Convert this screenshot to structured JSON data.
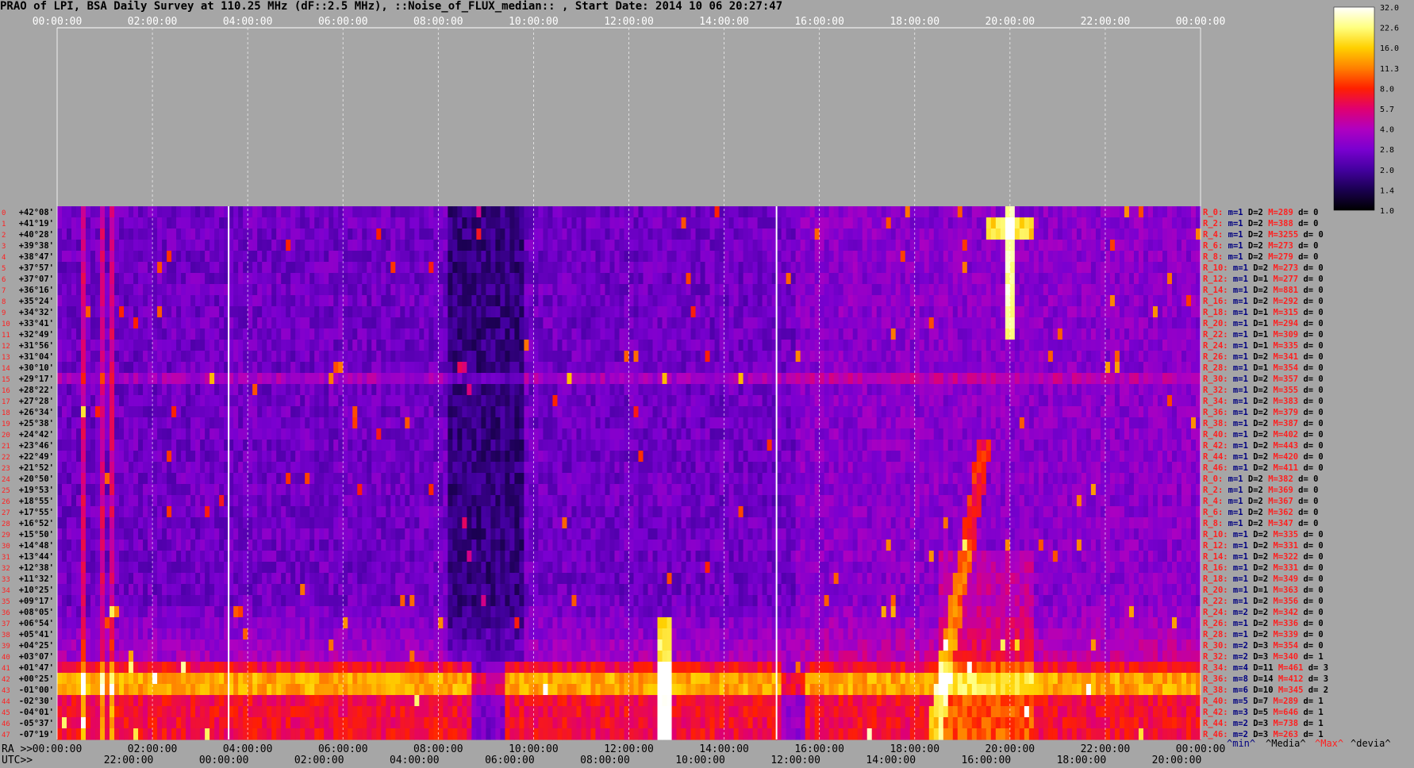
{
  "title": "PRAO of LPI, BSA Daily Survey at 110.25 MHz (dF::2.5 MHz), ::Noise_of_FLUX_median:: , Start Date: 2014 10 06 20:27:47",
  "chart_data": {
    "type": "heatmap",
    "top_time_ticks": [
      "00:00:00",
      "02:00:00",
      "04:00:00",
      "06:00:00",
      "08:00:00",
      "10:00:00",
      "12:00:00",
      "14:00:00",
      "16:00:00",
      "18:00:00",
      "20:00:00",
      "22:00:00",
      "00:00:00"
    ],
    "bottom_ra_prefix": "RA >>",
    "bottom_ra_ticks": [
      "00:00:00",
      "02:00:00",
      "04:00:00",
      "06:00:00",
      "08:00:00",
      "10:00:00",
      "12:00:00",
      "14:00:00",
      "16:00:00",
      "18:00:00",
      "20:00:00",
      "22:00:00",
      "00:00:00"
    ],
    "bottom_utc_prefix": "UTC>>",
    "bottom_utc_ticks": [
      "22:00:00",
      "00:00:00",
      "02:00:00",
      "04:00:00",
      "06:00:00",
      "08:00:00",
      "10:00:00",
      "12:00:00",
      "14:00:00",
      "16:00:00",
      "18:00:00",
      "20:00:00"
    ],
    "declinations": [
      "+42°08'",
      "+41°19'",
      "+40°28'",
      "+39°38'",
      "+38°47'",
      "+37°57'",
      "+37°07'",
      "+36°16'",
      "+35°24'",
      "+34°32'",
      "+33°41'",
      "+32°49'",
      "+31°56'",
      "+31°04'",
      "+30°10'",
      "+29°17'",
      "+28°22'",
      "+27°28'",
      "+26°34'",
      "+25°38'",
      "+24°42'",
      "+23°46'",
      "+22°49'",
      "+21°52'",
      "+20°50'",
      "+19°53'",
      "+18°55'",
      "+17°55'",
      "+16°52'",
      "+15°50'",
      "+14°48'",
      "+13°44'",
      "+12°38'",
      "+11°32'",
      "+10°25'",
      "+09°17'",
      "+08°05'",
      "+06°54'",
      "+05°41'",
      "+04°25'",
      "+03°07'",
      "+01°47'",
      "+00°25'",
      "-01°00'",
      "-02°30'",
      "-04°01'",
      "-05°37'",
      "-07°19'"
    ],
    "row_stats": [
      {
        "r": "R_0:",
        "m": "m=1",
        "d": "D=2",
        "M": "M=289",
        "dv": "d= 0"
      },
      {
        "r": "R_2:",
        "m": "m=1",
        "d": "D=2",
        "M": "M=388",
        "dv": "d= 0"
      },
      {
        "r": "R_4:",
        "m": "m=1",
        "d": "D=2",
        "M": "M=3255",
        "dv": "d= 0"
      },
      {
        "r": "R_6:",
        "m": "m=1",
        "d": "D=2",
        "M": "M=273",
        "dv": "d= 0"
      },
      {
        "r": "R_8:",
        "m": "m=1",
        "d": "D=2",
        "M": "M=279",
        "dv": "d= 0"
      },
      {
        "r": "R_10:",
        "m": "m=1",
        "d": "D=2",
        "M": "M=273",
        "dv": "d= 0"
      },
      {
        "r": "R_12:",
        "m": "m=1",
        "d": "D=1",
        "M": "M=277",
        "dv": "d= 0"
      },
      {
        "r": "R_14:",
        "m": "m=1",
        "d": "D=2",
        "M": "M=881",
        "dv": "d= 0"
      },
      {
        "r": "R_16:",
        "m": "m=1",
        "d": "D=2",
        "M": "M=292",
        "dv": "d= 0"
      },
      {
        "r": "R_18:",
        "m": "m=1",
        "d": "D=1",
        "M": "M=315",
        "dv": "d= 0"
      },
      {
        "r": "R_20:",
        "m": "m=1",
        "d": "D=1",
        "M": "M=294",
        "dv": "d= 0"
      },
      {
        "r": "R_22:",
        "m": "m=1",
        "d": "D=1",
        "M": "M=309",
        "dv": "d= 0"
      },
      {
        "r": "R_24:",
        "m": "m=1",
        "d": "D=1",
        "M": "M=335",
        "dv": "d= 0"
      },
      {
        "r": "R_26:",
        "m": "m=1",
        "d": "D=2",
        "M": "M=341",
        "dv": "d= 0"
      },
      {
        "r": "R_28:",
        "m": "m=1",
        "d": "D=1",
        "M": "M=354",
        "dv": "d= 0"
      },
      {
        "r": "R_30:",
        "m": "m=1",
        "d": "D=2",
        "M": "M=357",
        "dv": "d= 0"
      },
      {
        "r": "R_32:",
        "m": "m=1",
        "d": "D=2",
        "M": "M=355",
        "dv": "d= 0"
      },
      {
        "r": "R_34:",
        "m": "m=1",
        "d": "D=2",
        "M": "M=383",
        "dv": "d= 0"
      },
      {
        "r": "R_36:",
        "m": "m=1",
        "d": "D=2",
        "M": "M=379",
        "dv": "d= 0"
      },
      {
        "r": "R_38:",
        "m": "m=1",
        "d": "D=2",
        "M": "M=387",
        "dv": "d= 0"
      },
      {
        "r": "R_40:",
        "m": "m=1",
        "d": "D=2",
        "M": "M=402",
        "dv": "d= 0"
      },
      {
        "r": "R_42:",
        "m": "m=1",
        "d": "D=2",
        "M": "M=443",
        "dv": "d= 0"
      },
      {
        "r": "R_44:",
        "m": "m=1",
        "d": "D=2",
        "M": "M=420",
        "dv": "d= 0"
      },
      {
        "r": "R_46:",
        "m": "m=1",
        "d": "D=2",
        "M": "M=411",
        "dv": "d= 0"
      },
      {
        "r": "R_0:",
        "m": "m=1",
        "d": "D=2",
        "M": "M=382",
        "dv": "d= 0"
      },
      {
        "r": "R_2:",
        "m": "m=1",
        "d": "D=2",
        "M": "M=369",
        "dv": "d= 0"
      },
      {
        "r": "R_4:",
        "m": "m=1",
        "d": "D=2",
        "M": "M=367",
        "dv": "d= 0"
      },
      {
        "r": "R_6:",
        "m": "m=1",
        "d": "D=2",
        "M": "M=362",
        "dv": "d= 0"
      },
      {
        "r": "R_8:",
        "m": "m=1",
        "d": "D=2",
        "M": "M=347",
        "dv": "d= 0"
      },
      {
        "r": "R_10:",
        "m": "m=1",
        "d": "D=2",
        "M": "M=335",
        "dv": "d= 0"
      },
      {
        "r": "R_12:",
        "m": "m=1",
        "d": "D=2",
        "M": "M=331",
        "dv": "d= 0"
      },
      {
        "r": "R_14:",
        "m": "m=1",
        "d": "D=2",
        "M": "M=322",
        "dv": "d= 0"
      },
      {
        "r": "R_16:",
        "m": "m=1",
        "d": "D=2",
        "M": "M=331",
        "dv": "d= 0"
      },
      {
        "r": "R_18:",
        "m": "m=1",
        "d": "D=2",
        "M": "M=349",
        "dv": "d= 0"
      },
      {
        "r": "R_20:",
        "m": "m=1",
        "d": "D=1",
        "M": "M=363",
        "dv": "d= 0"
      },
      {
        "r": "R_22:",
        "m": "m=1",
        "d": "D=2",
        "M": "M=356",
        "dv": "d= 0"
      },
      {
        "r": "R_24:",
        "m": "m=2",
        "d": "D=2",
        "M": "M=342",
        "dv": "d= 0"
      },
      {
        "r": "R_26:",
        "m": "m=1",
        "d": "D=2",
        "M": "M=336",
        "dv": "d= 0"
      },
      {
        "r": "R_28:",
        "m": "m=1",
        "d": "D=2",
        "M": "M=339",
        "dv": "d= 0"
      },
      {
        "r": "R_30:",
        "m": "m=2",
        "d": "D=3",
        "M": "M=354",
        "dv": "d= 0"
      },
      {
        "r": "R_32:",
        "m": "m=2",
        "d": "D=3",
        "M": "M=340",
        "dv": "d= 1"
      },
      {
        "r": "R_34:",
        "m": "m=4",
        "d": "D=11",
        "M": "M=461",
        "dv": "d= 3"
      },
      {
        "r": "R_36:",
        "m": "m=8",
        "d": "D=14",
        "M": "M=412",
        "dv": "d= 3"
      },
      {
        "r": "R_38:",
        "m": "m=6",
        "d": "D=10",
        "M": "M=345",
        "dv": "d= 2"
      },
      {
        "r": "R_40:",
        "m": "m=5",
        "d": "D=7",
        "M": "M=289",
        "dv": "d= 1"
      },
      {
        "r": "R_42:",
        "m": "m=3",
        "d": "D=5",
        "M": "M=646",
        "dv": "d= 1"
      },
      {
        "r": "R_44:",
        "m": "m=2",
        "d": "D=3",
        "M": "M=738",
        "dv": "d= 1"
      },
      {
        "r": "R_46:",
        "m": "m=2",
        "d": "D=3",
        "M": "M=263",
        "dv": "d= 1"
      }
    ],
    "footer_legend": [
      "^min^",
      "^Media^",
      "^Max^",
      "^devia^"
    ],
    "colorbar_ticks": [
      "32.0",
      "22.6",
      "16.0",
      "11.3",
      "8.0",
      "5.7",
      "4.0",
      "2.8",
      "2.0",
      "1.4",
      "1.0"
    ],
    "colormap": [
      "#000000",
      "#1a0050",
      "#4400a0",
      "#7a00d0",
      "#b000c0",
      "#e00070",
      "#ff2000",
      "#ff8000",
      "#ffd000",
      "#ffff80",
      "#ffffff"
    ],
    "bright_source_ra_hours": 20.0
  }
}
